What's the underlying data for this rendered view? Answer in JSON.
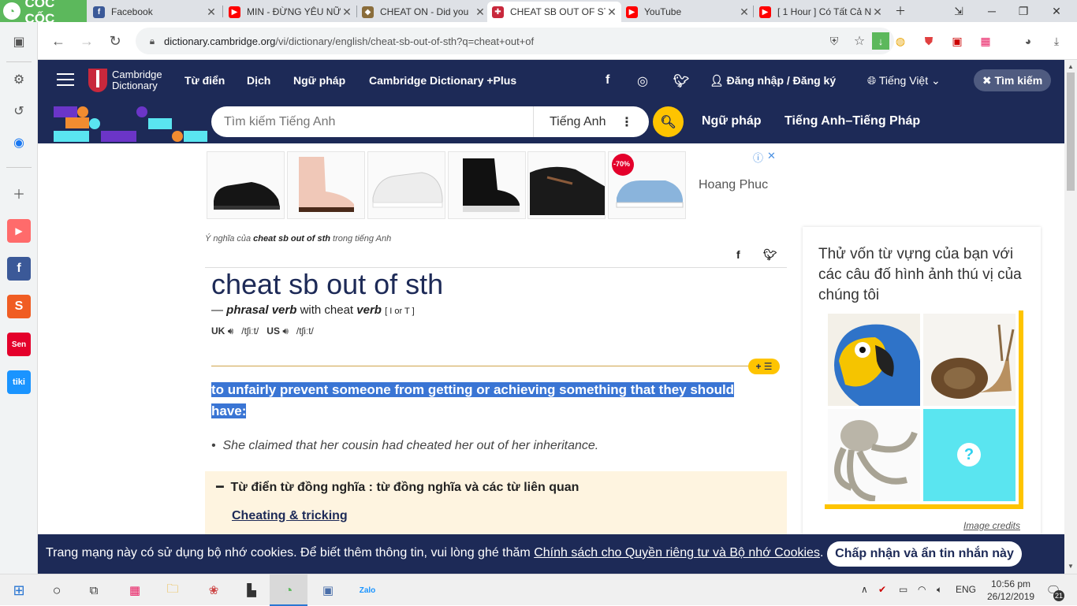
{
  "browser": {
    "brand": "CỐC CỐC",
    "tabs": [
      {
        "title": "Facebook",
        "icon": "facebook-icon",
        "color": "#3b5998"
      },
      {
        "title": "MIN - ĐỪNG YÊU NỮ",
        "icon": "youtube-icon",
        "color": "#ff0000"
      },
      {
        "title": "CHEAT ON - Did you",
        "icon": "cheat-icon",
        "color": "#8a6d3b"
      },
      {
        "title": "CHEAT SB OUT OF ST",
        "icon": "cambridge-icon",
        "color": "#c8283c",
        "active": true
      },
      {
        "title": "YouTube",
        "icon": "youtube-icon",
        "color": "#ff0000"
      },
      {
        "title": "[ 1 Hour ] Có Tất Cả N",
        "icon": "youtube-icon",
        "color": "#ff0000"
      }
    ],
    "url_host": "dictionary.cambridge.org",
    "url_path": "/vi/dictionary/english/cheat-sb-out-of-sth?q=cheat+out+of"
  },
  "header": {
    "logo_line1": "Cambridge",
    "logo_line2": "Dictionary",
    "nav": [
      "Từ điển",
      "Dịch",
      "Ngữ pháp",
      "Cambridge Dictionary +Plus"
    ],
    "login": "Đăng nhập / Đăng ký",
    "language": "Tiếng Việt",
    "search_button": "Tìm kiếm"
  },
  "search": {
    "placeholder": "Tìm kiếm Tiếng Anh",
    "dictionary": "Tiếng Anh",
    "links": [
      "Ngữ pháp",
      "Tiếng Anh–Tiếng Pháp"
    ]
  },
  "ad": {
    "brand": "Hoang Phuc",
    "badge": "-70%"
  },
  "entry": {
    "meaning_prefix": "Ý nghĩa của",
    "meaning_word": "cheat sb out of sth",
    "meaning_suffix": "trong tiếng Anh",
    "headword": "cheat sb out of sth",
    "dash": "—",
    "pos": "phrasal verb",
    "with_text": "with cheat",
    "verb": "verb",
    "grammar": "[ I or T ]",
    "uk_label": "UK",
    "uk_ipa": "/tʃiːt/",
    "us_label": "US",
    "us_ipa": "/tʃiːt/",
    "badge": "+ ☰",
    "definition": "to unfairly prevent someone from getting or achieving something that they should have:",
    "example": "She claimed that her cousin had cheated her out of her inheritance.",
    "thesaurus_title": "Từ điển từ đồng nghĩa : từ đồng nghĩa và các từ liên quan",
    "thesaurus_link": "Cheating & tricking"
  },
  "quiz": {
    "title": "Thử vốn từ vựng của bạn với các câu đố hình ảnh thú vị của chúng tôi",
    "credits": "Image credits"
  },
  "cookie": {
    "text": "Trang mạng này có sử dụng bộ nhớ cookies. Để biết thêm thông tin, vui lòng ghé thăm",
    "link": "Chính sách cho Quyền riêng tư và Bộ nhớ Cookies",
    "period": ".",
    "button": "Chấp nhận và ẩn tin nhắn này"
  },
  "taskbar": {
    "lang": "ENG",
    "time": "10:56 pm",
    "date": "26/12/2019",
    "notifications": "21"
  },
  "colors": {
    "brand_navy": "#1d2a57",
    "accent_yellow": "#fec400",
    "highlight_blue": "#3a75d4",
    "coccoc_green": "#5cb85c"
  }
}
